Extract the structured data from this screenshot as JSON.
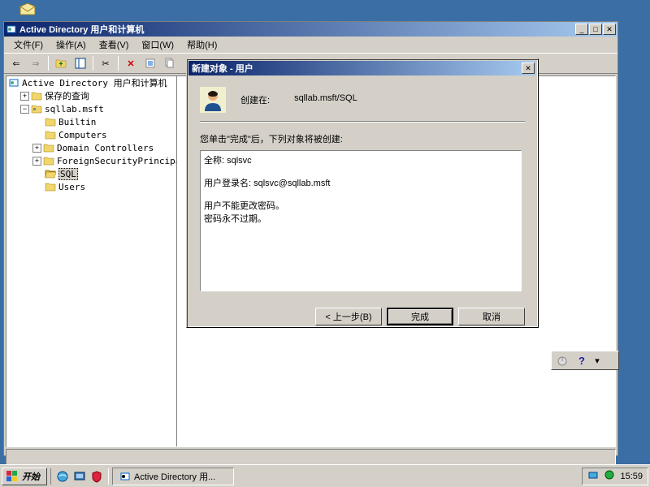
{
  "desktop": {
    "envelope_tooltip": "邮件"
  },
  "main_window": {
    "title": "Active Directory 用户和计算机",
    "menu": [
      "文件(F)",
      "操作(A)",
      "查看(V)",
      "窗口(W)",
      "帮助(H)"
    ]
  },
  "tree": {
    "root": "Active Directory 用户和计算机",
    "saved_queries": "保存的查询",
    "domain": "sqllab.msft",
    "nodes": [
      {
        "name": "Builtin"
      },
      {
        "name": "Computers"
      },
      {
        "name": "Domain Controllers"
      },
      {
        "name": "ForeignSecurityPrincipals"
      },
      {
        "name": "SQL",
        "selected": true
      },
      {
        "name": "Users"
      }
    ]
  },
  "dialog": {
    "title": "新建对象 - 用户",
    "created_in_label": "创建在:",
    "created_in_value": "sqllab.msft/SQL",
    "instruction": "您单击\"完成\"后，下列对象将被创建:",
    "details": {
      "full_name_label": "全称:",
      "full_name_value": "sqlsvc",
      "logon_label": "用户登录名:",
      "logon_value": "sqlsvc@sqllab.msft",
      "cannot_change_pw": "用户不能更改密码。",
      "pw_never_expires": "密码永不过期。"
    },
    "buttons": {
      "back": "< 上一步(B)",
      "finish": "完成",
      "cancel": "取消"
    }
  },
  "mini_toolbar": {
    "help_tooltip": "帮助"
  },
  "taskbar": {
    "start": "开始",
    "task": "Active Directory 用...",
    "clock": "15:59"
  }
}
